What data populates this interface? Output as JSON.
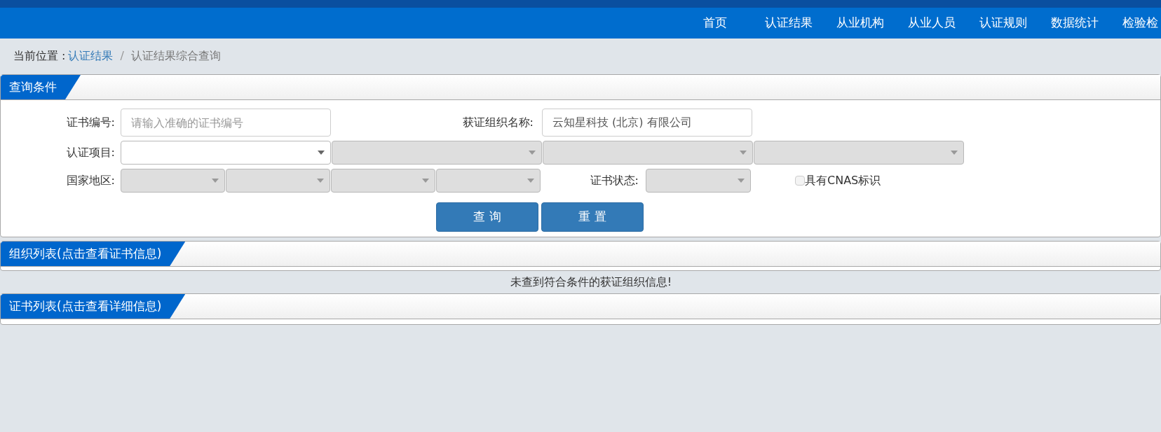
{
  "nav": [
    {
      "label": "首页"
    },
    {
      "label": "认证结果"
    },
    {
      "label": "从业机构"
    },
    {
      "label": "从业人员"
    },
    {
      "label": "认证规则"
    },
    {
      "label": "数据统计"
    },
    {
      "label": "检验检"
    }
  ],
  "breadcrumb": {
    "prefix": "当前位置 :",
    "link": "认证结果",
    "separator": "/",
    "current": "认证结果综合查询"
  },
  "query_panel": {
    "title": "查询条件",
    "cert_number": {
      "label": "证书编号:",
      "placeholder": "请输入准确的证书编号"
    },
    "org_name": {
      "label": "获证组织名称:",
      "value": "云知星科技 (北京) 有限公司"
    },
    "cert_project": {
      "label": "认证项目:",
      "selects": [
        {
          "disabled": false
        },
        {
          "disabled": true
        },
        {
          "disabled": true
        },
        {
          "disabled": true
        }
      ]
    },
    "region": {
      "label": "国家地区:",
      "selects": [
        {
          "disabled": true
        },
        {
          "disabled": true
        },
        {
          "disabled": true
        },
        {
          "disabled": true
        }
      ]
    },
    "cert_status": {
      "label": "证书状态:",
      "disabled": true
    },
    "cnas": {
      "label": "具有CNAS标识",
      "checked": false,
      "disabled": true
    },
    "buttons": [
      "查 询",
      "重 置"
    ]
  },
  "org_panel": {
    "title": "组织列表(点击查看证书信息)",
    "message": "未查到符合条件的获证组织信息!"
  },
  "cert_panel": {
    "title": "证书列表(点击查看详细信息)"
  }
}
